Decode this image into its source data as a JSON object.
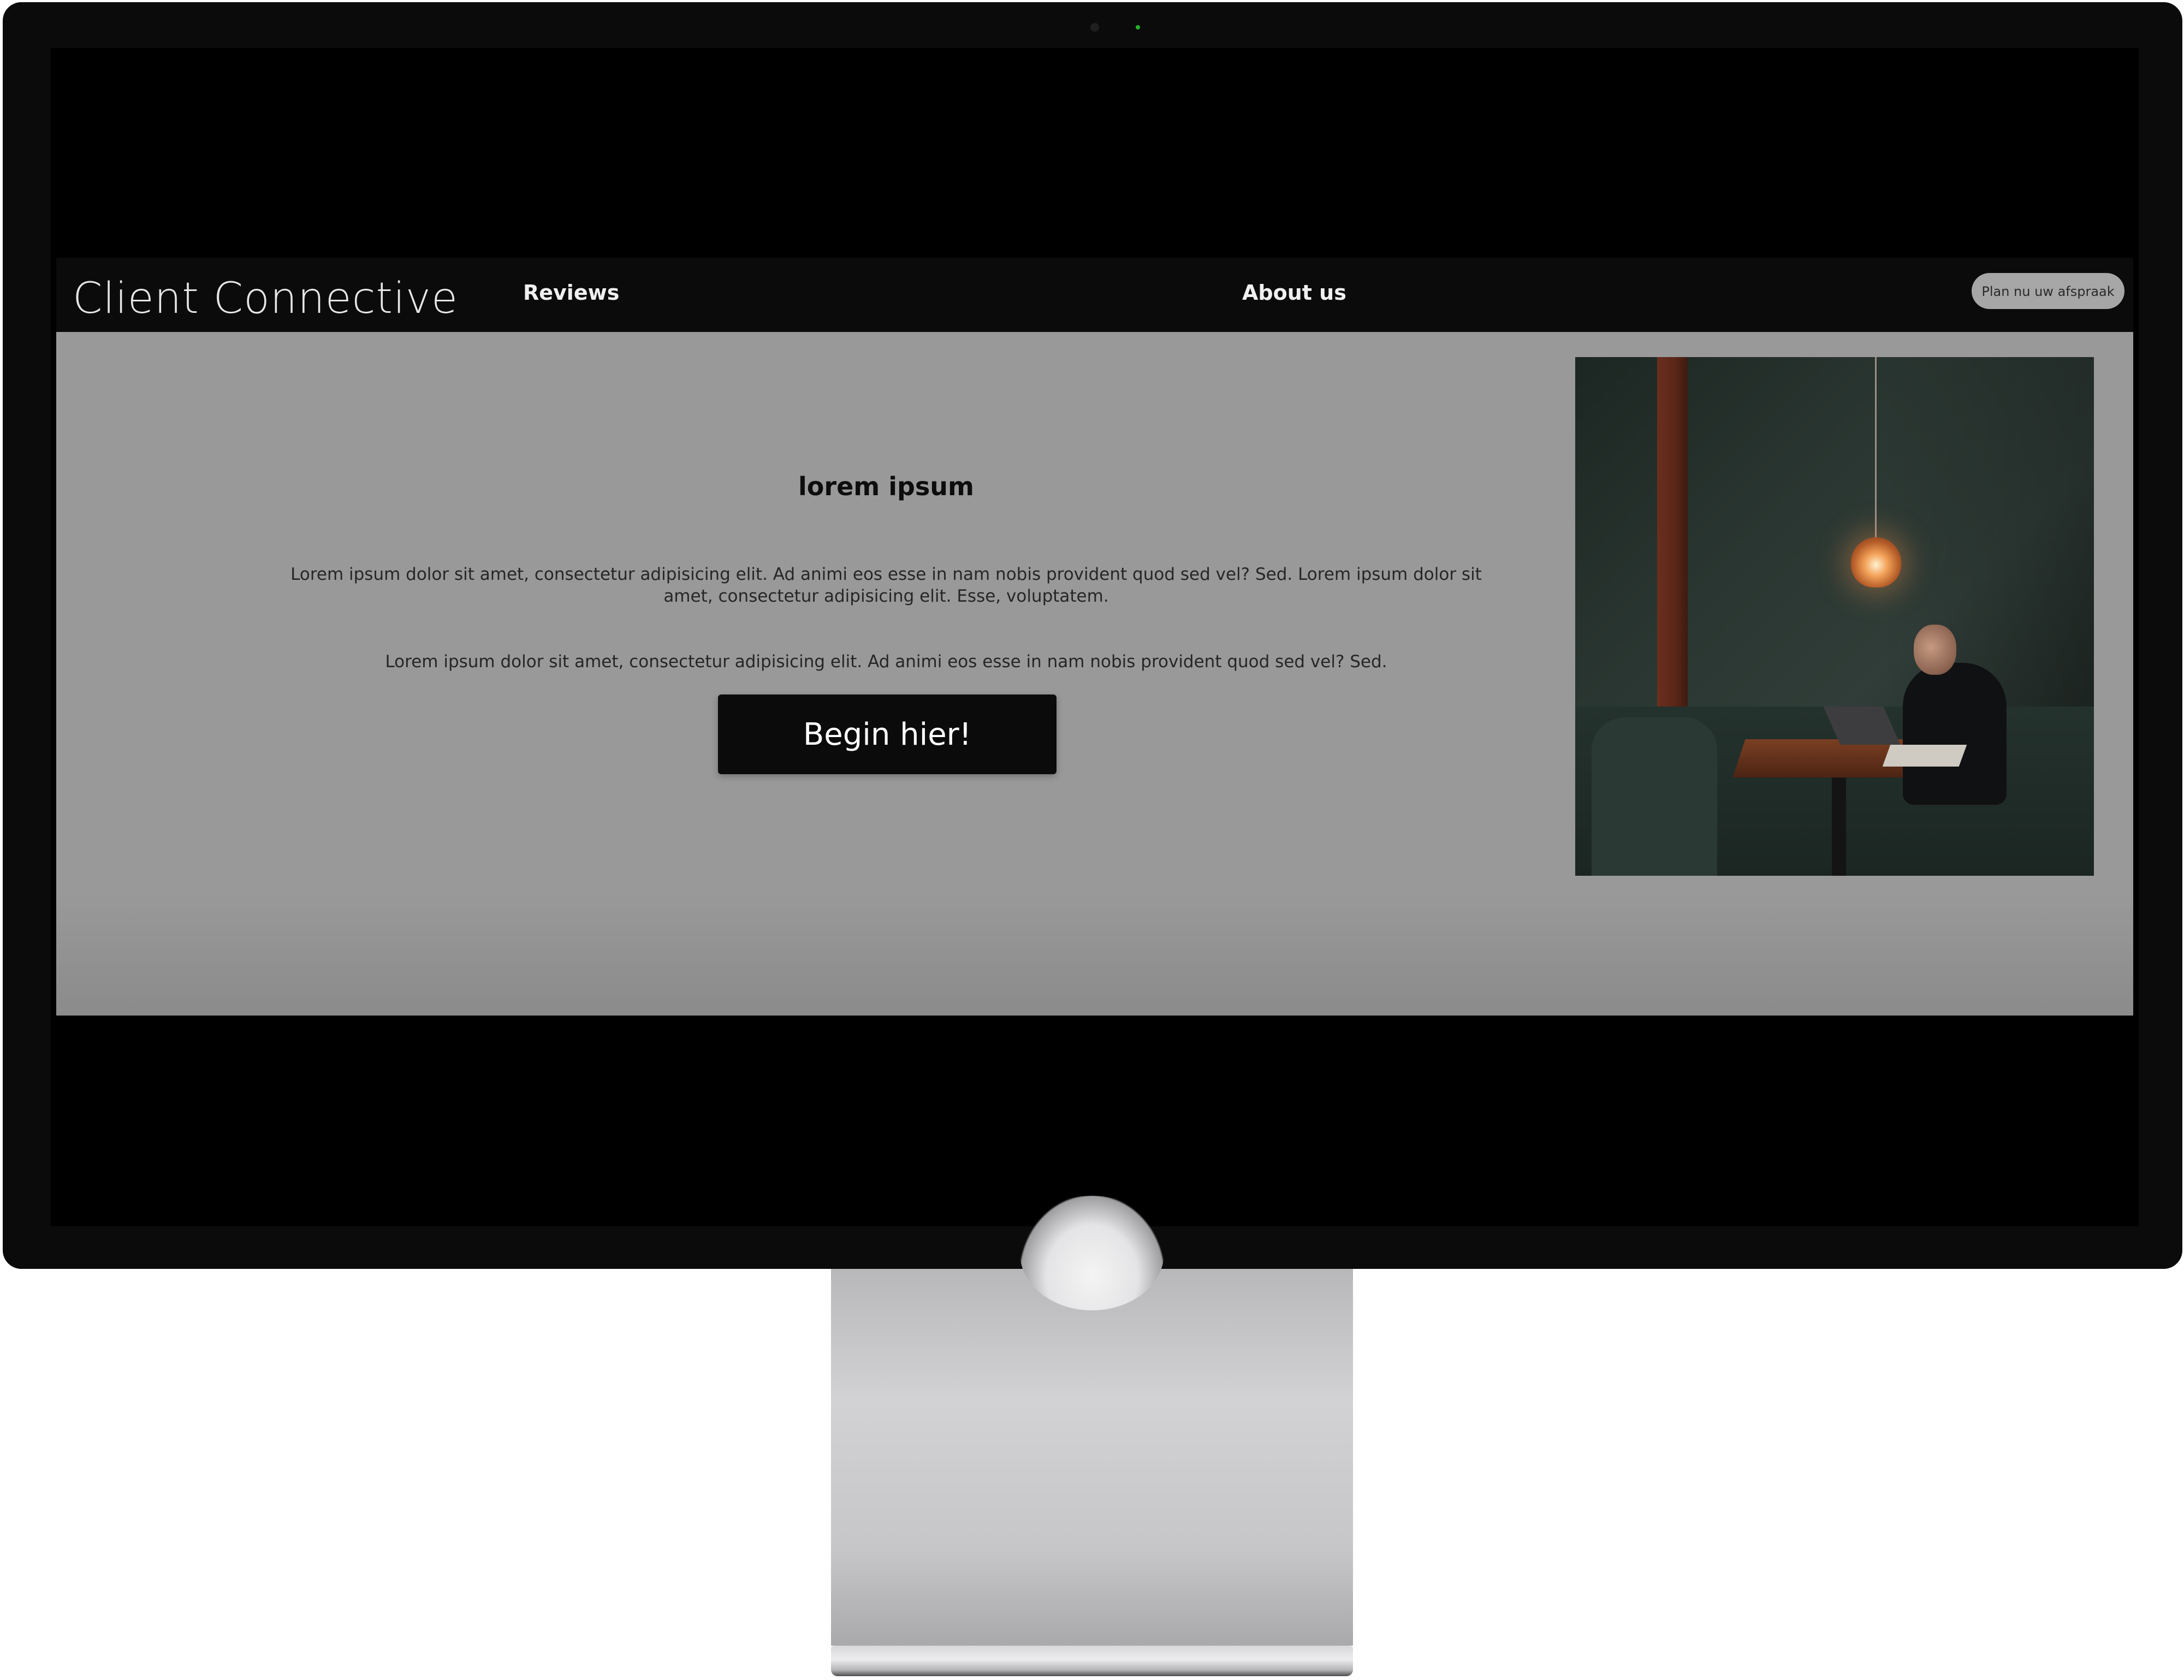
{
  "site": {
    "brand": "Client Connective",
    "nav": {
      "reviews": "Reviews",
      "about": "About us"
    },
    "cta_small": "Plan nu uw afspraak"
  },
  "hero": {
    "heading": "lorem ipsum",
    "paragraph_1": "Lorem ipsum dolor sit amet, consectetur adipisicing elit. Ad animi eos esse in nam nobis provident quod sed vel? Sed. Lorem ipsum dolor sit amet, consectetur adipisicing elit. Esse, voluptatem.",
    "paragraph_2": "Lorem ipsum dolor sit amet, consectetur adipisicing elit. Ad animi eos esse in nam nobis provident quod sed vel? Sed.",
    "button": "Begin hier!"
  },
  "colors": {
    "header_bg": "#0b0b0b",
    "hero_bg": "#999999",
    "button_bg": "#0b0b0b",
    "cta_small_bg": "#a6a6a6"
  },
  "icons": {
    "camera": "camera-dot",
    "camera_led": "status-led"
  }
}
